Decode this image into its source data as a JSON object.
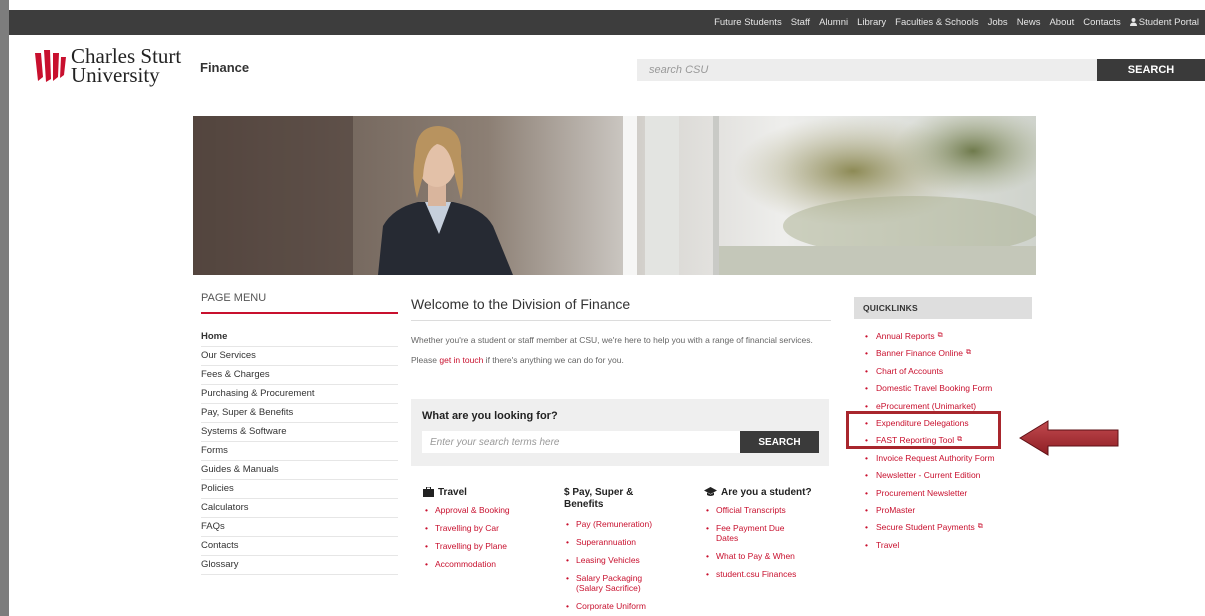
{
  "topnav": {
    "items": [
      "Future Students",
      "Staff",
      "Alumni",
      "Library",
      "Faculties & Schools",
      "Jobs",
      "News",
      "About",
      "Contacts"
    ],
    "portal": "Student Portal"
  },
  "header": {
    "logo_line1": "Charles Sturt",
    "logo_line2": "University",
    "site_name": "Finance",
    "search_placeholder": "search CSU",
    "search_button": "SEARCH"
  },
  "page_menu": {
    "heading": "PAGE MENU",
    "items": [
      "Home",
      "Our Services",
      "Fees & Charges",
      "Purchasing & Procurement",
      "Pay, Super & Benefits",
      "Systems & Software",
      "Forms",
      "Guides & Manuals",
      "Policies",
      "Calculators",
      "FAQs",
      "Contacts",
      "Glossary"
    ]
  },
  "main": {
    "title": "Welcome to the Division of Finance",
    "intro": "Whether you're a student or staff member at CSU, we're here to help you with a range of financial services.",
    "contact_prefix": "Please ",
    "contact_link": "get in touch",
    "contact_suffix": " if there's anything we can do for you."
  },
  "looking": {
    "title": "What are you looking for?",
    "placeholder": "Enter your search terms here",
    "button": "SEARCH"
  },
  "columns": {
    "travel": {
      "title": "Travel",
      "items": [
        "Approval & Booking",
        "Travelling by Car",
        "Travelling by Plane",
        "Accommodation"
      ]
    },
    "pay": {
      "title": "$ Pay, Super & Benefits",
      "items": [
        "Pay (Remuneration)",
        "Superannuation",
        "Leasing Vehicles",
        "Salary Packaging (Salary Sacrifice)",
        "Corporate Uniform"
      ]
    },
    "student": {
      "title": "Are you a student?",
      "items": [
        "Official Transcripts",
        "Fee Payment Due Dates",
        "What to Pay & When",
        "student.csu Finances"
      ]
    }
  },
  "quicklinks": {
    "heading": "QUICKLINKS",
    "items": [
      "Annual Reports",
      "Banner Finance Online",
      "Chart of Accounts",
      "Domestic Travel Booking Form",
      "eProcurement (Unimarket)",
      "Expenditure Delegations",
      "FAST Reporting Tool",
      "Invoice Request Authority Form",
      "Newsletter - Current Edition",
      "Procurement Newsletter",
      "ProMaster",
      "Secure Student Payments",
      "Travel"
    ]
  },
  "colors": {
    "accent": "#c8102e",
    "dark_bar": "#3d3d3d",
    "annotation": "#a8262d"
  }
}
